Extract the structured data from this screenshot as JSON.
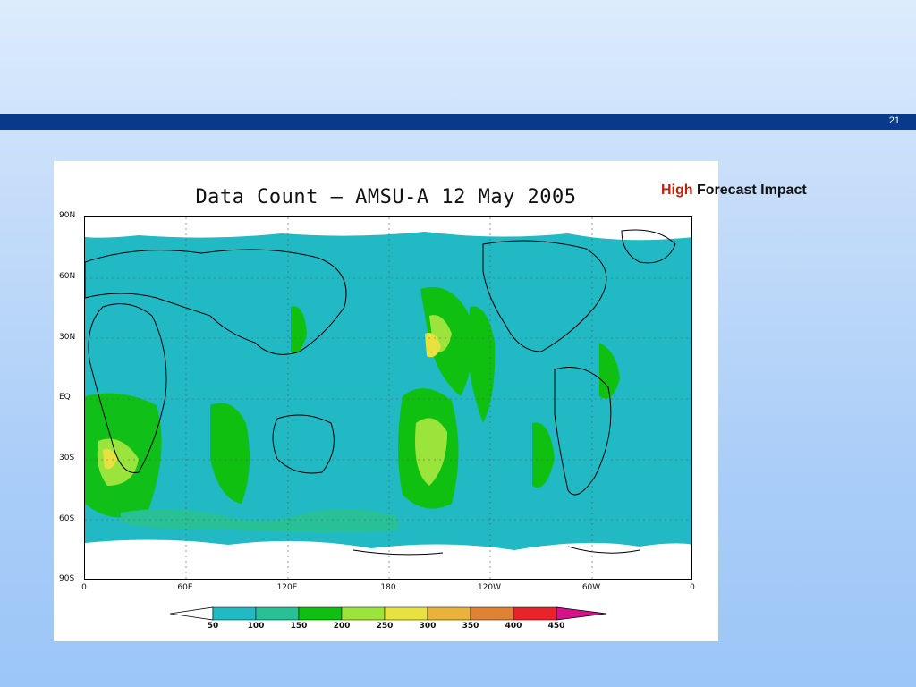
{
  "slide": {
    "page_number": "21",
    "annotation": {
      "highlight": "High",
      "rest": "Forecast Impact"
    },
    "colors": {
      "header_bar": "#083a8c",
      "highlight": "#c0200c"
    }
  },
  "chart_data": {
    "type": "heatmap",
    "title": "Data Count — AMSU-A  12 May 2005",
    "y_ticks": [
      "90N",
      "60N",
      "30N",
      "EQ",
      "30S",
      "60S",
      "90S"
    ],
    "x_ticks": [
      "0",
      "60E",
      "120E",
      "180",
      "120W",
      "60W",
      "0"
    ],
    "colorbar": {
      "levels": [
        "50",
        "100",
        "150",
        "200",
        "250",
        "300",
        "350",
        "400",
        "450"
      ],
      "colors": [
        "#ffffff",
        "#20b9c4",
        "#27c195",
        "#10c010",
        "#9be43c",
        "#e8e241",
        "#e9b33a",
        "#e0822f",
        "#e8232a",
        "#d5128a"
      ]
    }
  }
}
